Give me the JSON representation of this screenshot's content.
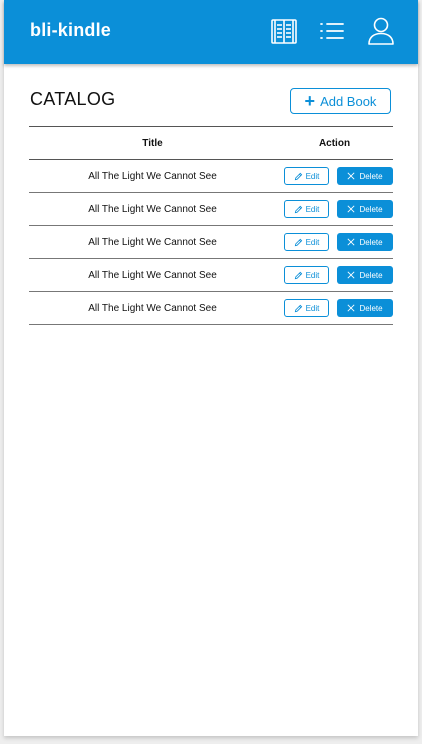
{
  "app": {
    "brand": "bli-kindle",
    "accent_color": "#0b8fd8",
    "nav_icons": [
      "book-icon",
      "list-icon",
      "user-icon"
    ]
  },
  "page": {
    "title": "CATALOG",
    "add_button_label": "Add Book"
  },
  "table": {
    "columns": [
      "Title",
      "Action"
    ],
    "rows": [
      {
        "title": "All The Light We Cannot See",
        "edit_label": "Edit",
        "delete_label": "Delete"
      },
      {
        "title": "All The Light We Cannot See",
        "edit_label": "Edit",
        "delete_label": "Delete"
      },
      {
        "title": "All The Light We Cannot See",
        "edit_label": "Edit",
        "delete_label": "Delete"
      },
      {
        "title": "All The Light We Cannot See",
        "edit_label": "Edit",
        "delete_label": "Delete"
      },
      {
        "title": "All The Light We Cannot See",
        "edit_label": "Edit",
        "delete_label": "Delete"
      }
    ]
  }
}
